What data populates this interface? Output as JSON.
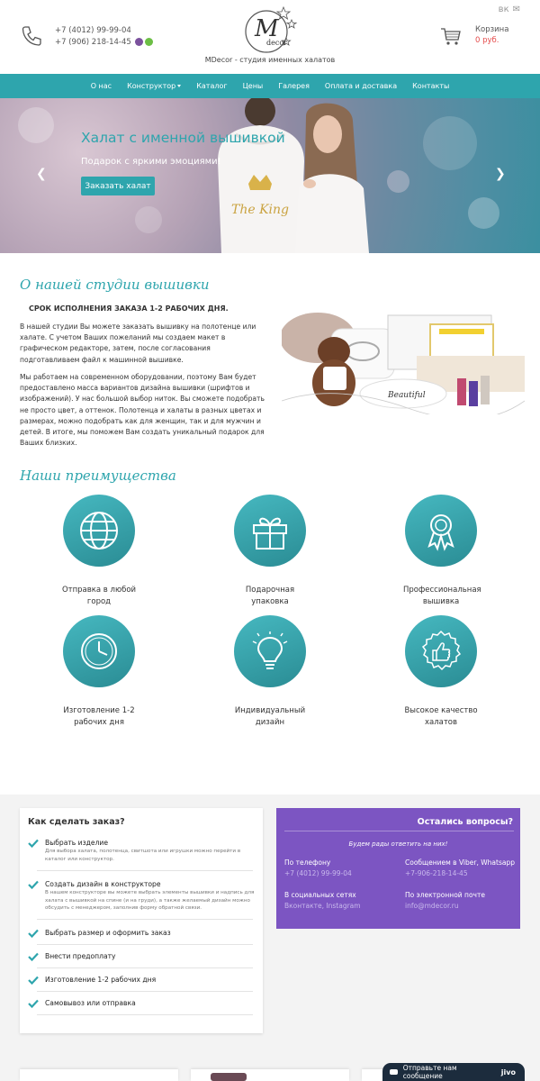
{
  "header": {
    "phones": [
      "+7 (4012) 99-99-04",
      "+7 (906) 218-14-45"
    ],
    "tagline": "MDecor - студия именных халатов",
    "logo_text": "decor",
    "social": {
      "vk": "vk-icon",
      "mail": "mail-icon"
    },
    "cart": {
      "label": "Корзина",
      "sum": "0 руб."
    }
  },
  "nav": {
    "items": [
      "О нас",
      "Конструктор",
      "Каталог",
      "Цены",
      "Галерея",
      "Оплата и доставка",
      "Контакты"
    ]
  },
  "hero": {
    "title": "Халат с именной вышивкой",
    "subtitle": "Подарок с яркими эмоциями!",
    "button": "Заказать халат",
    "robe_text": "The King"
  },
  "about": {
    "title": "О нашей студии вышивки",
    "deadline": "СРОК ИСПОЛНЕНИЯ ЗАКАЗА 1-2 РАБОЧИХ ДНЯ.",
    "p1": "В нашей студии Вы можете заказать вышивку на полотенце или халате. С учетом Ваших пожеланий мы создаем макет в графическом редакторе, затем, после согласования подготавливаем файл к машинной вышивке.",
    "p2": "Мы работаем на современном оборудовании, поэтому Вам будет предоставлено масса вариантов дизайна вышивки (шрифтов и изображений). У нас большой выбор ниток. Вы сможете подобрать не просто цвет, а оттенок. Полотенца и халаты в разных цветах и размерах, можно подобрать как для женщин, так и для мужчин и детей. В итоге, мы поможем Вам создать уникальный подарок для Ваших близких."
  },
  "advantages": {
    "title": "Наши преимущества",
    "items": [
      {
        "label": "Отправка в любой город",
        "icon": "globe-icon"
      },
      {
        "label": "Подарочная упаковка",
        "icon": "gift-icon"
      },
      {
        "label": "Профессиональная вышивка",
        "icon": "award-icon"
      },
      {
        "label": "Изготовление 1-2 рабочих дня",
        "icon": "clock-icon"
      },
      {
        "label": "Индивидуальный дизайн",
        "icon": "lightbulb-icon"
      },
      {
        "label": "Высокое качество халатов",
        "icon": "thumbs-up-icon"
      }
    ]
  },
  "steps": {
    "title": "Как сделать заказ?",
    "items": [
      {
        "title": "Выбрать изделие",
        "desc": "Для выбора халата, полотенца, свитшота или игрушки можно перейти в каталог или конструктор."
      },
      {
        "title": "Создать дизайн в конструкторе",
        "desc": "В нашем конструкторе вы можете выбрать элементы вышивки и надпись для халата с вышивкой на спине (и на груди), а также желаемый дизайн можно обсудить с менеджером, заполнив форму обратной связи."
      },
      {
        "title": "Выбрать размер и оформить заказ",
        "desc": ""
      },
      {
        "title": "Внести предоплату",
        "desc": ""
      },
      {
        "title": "Изготовление 1-2 рабочих дня",
        "desc": ""
      },
      {
        "title": "Самовывоз или отправка",
        "desc": ""
      }
    ]
  },
  "questions": {
    "title": "Остались вопросы?",
    "subtitle": "Будем рады ответить на них!",
    "phone_label": "По телефону",
    "phone_value": "+7 (4012) 99-99-04",
    "messenger_label": "Сообщением в Viber, Whatsapp",
    "messenger_value": "+7-906-218-14-45",
    "social_label": "В социальных сетях",
    "social_value": "Вконтакте, Instagram",
    "email_label": "По электронной почте",
    "email_value": "info@mdecor.ru"
  },
  "chat": {
    "label": "Отправьте нам сообщение",
    "brand": "jivo"
  },
  "colors": {
    "accent": "#2ea5ad",
    "purple": "#7c55c2",
    "price": "#e54b4b",
    "chat": "#1c2c3d"
  }
}
